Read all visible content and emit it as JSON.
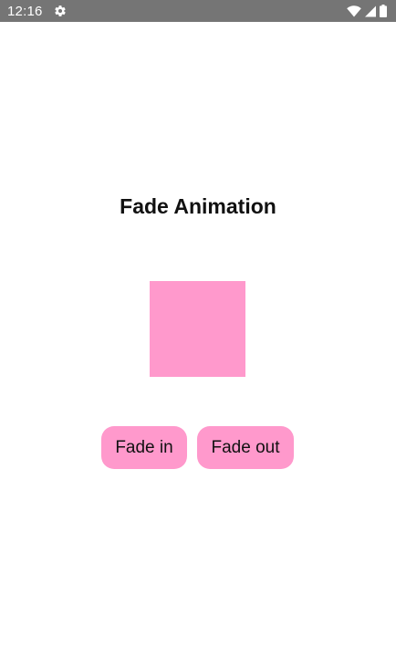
{
  "status_bar": {
    "time": "12:16",
    "icons": [
      "settings-icon",
      "wifi-icon",
      "cell-signal-icon",
      "battery-icon"
    ],
    "background": "#757575"
  },
  "main": {
    "title": "Fade Animation",
    "box_color": "#ff99cc",
    "buttons": [
      {
        "label": "Fade in"
      },
      {
        "label": "Fade out"
      }
    ]
  }
}
